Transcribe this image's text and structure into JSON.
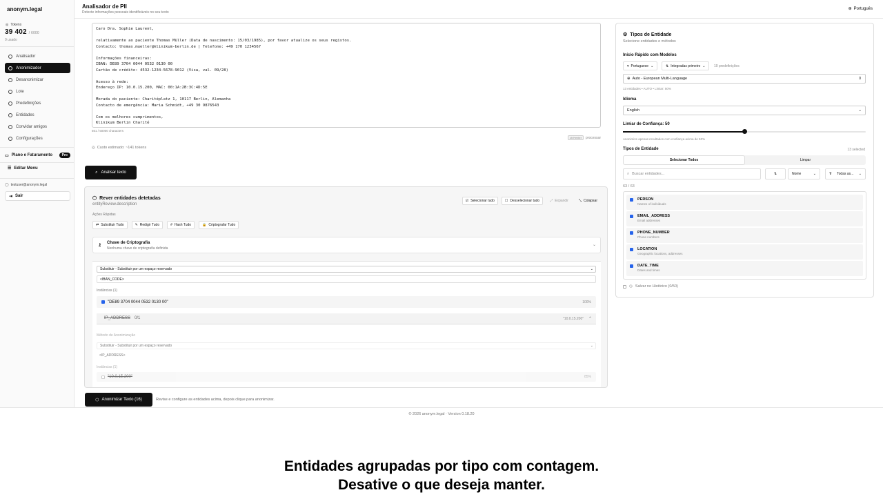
{
  "brand": "anonym.legal",
  "tokens": {
    "label": "Tokens",
    "count": "39 402",
    "total": "/ 6000",
    "used": "0 usado"
  },
  "nav": [
    {
      "label": "Analisador"
    },
    {
      "label": "Anonimizador"
    },
    {
      "label": "Desanonimizar"
    },
    {
      "label": "Lote"
    },
    {
      "label": "Predefinições"
    },
    {
      "label": "Entidades"
    },
    {
      "label": "Convidar amigos"
    },
    {
      "label": "Configurações"
    }
  ],
  "plan": {
    "label": "Plano e Faturamento",
    "badge": "Pro"
  },
  "edit_menu": "Editar Menu",
  "user": {
    "email": "testuser@anonym.legal",
    "logout": "Sair"
  },
  "header": {
    "title": "Analisador de PII",
    "subtitle": "Detecte informações pessoais identificáveis no seu texto",
    "language": "Português"
  },
  "input": {
    "text": "Caro Dra. Sophie Laurent,\n\nrelativamente ao paciente Thomas Müller (Data de nascimento: 15/03/1985), por favor atualize os seus registos.\nContacto: thomas.mueller@klinikum-berlin.de | Telefone: +49 170 1234567\n\nInformações financeiras:\nIBAN: DE89 3704 0044 0532 0130 00\nCartão de crédito: 4532-1234-5678-9012 (Visa, val. 09/28)\n\nAcesso à rede:\nEndereço IP: 10.0.15.200, MAC: 00:1A:2B:3C:4D:5E\n\nMorada do paciente: Charitéplatz 1, 10117 Berlin, Alemanha\nContacto de emergência: Maria Schmidt, +49 30 9876543\n\nCom os melhores cumprimentos,\nKlinikum Berlin Charité",
    "char_count": "561 / 50000 characters",
    "kbd": "ctrl+enter",
    "hint_suffix": "processar",
    "cost": "Custo estimado: ~141 tokens"
  },
  "analyze_button": "Analisar texto",
  "review": {
    "title": "Rever entidades detetadas",
    "subtitle": "entityReview.description",
    "actions": [
      "Selecionar tudo",
      "Desselecionar tudo",
      "Expandir",
      "Colapsar"
    ],
    "quick_label": "Ações Rápidas",
    "quick": [
      "Substituir Tudo",
      "Redigir Tudo",
      "Hash Tudo",
      "Criptografar Tudo"
    ],
    "crypto_title": "Chave de Criptografia",
    "crypto_sub": "Nenhuma chave de criptografia definida",
    "method_select": "Substituir - Substituir por um espaço reservado",
    "iban_placeholder": "<IBAN_CODE>",
    "instances_label": "Instâncias (1)",
    "iban_value": "\"DE89 3704 0044 0532 0130 00\"",
    "iban_pct": "100%",
    "ip_name": "IP_ADDRESS",
    "ip_count": "0/1",
    "ip_preview": "\"10.0.15.200\"",
    "method_label": "Método de Anonimização",
    "ip_method": "Substituir - Substituir por um espaço reservado",
    "ip_placeholder": "<IP_ADDRESS>",
    "ip_instances_label": "Instâncias (1)",
    "ip_value": "\"10.0.15.200\"",
    "ip_pct": "85%"
  },
  "anon_button": "Anonimizar Texto (16)",
  "anon_hint": "Revise e configure as entidades acima, depois clique para anonimizar.",
  "footer": "© 2026 anonym.legal · Version 0.18.20",
  "right": {
    "title": "Tipos de Entidade",
    "subtitle": "Selecione entidades e métodos",
    "quick_label": "Início Rápido com Modelos",
    "lang_pill": "Portuguese",
    "sort_pill": "Integradas primeiro",
    "presets": "10 predefinições",
    "model": "Auto - European Multi-Language",
    "model_note": "13 entidades • AUTO • Limiar: 50%",
    "language_label": "Idioma",
    "language_value": "English",
    "confidence_label": "Limiar de Confiança: 50",
    "confidence_value": 0.5,
    "confidence_note": "Anonimize apenas resultados com confiança acima de 50%",
    "types_label": "Tipos de Entidade",
    "types_count": "13 selected",
    "select_all": "Selecionar Todos",
    "clear": "Limpar",
    "search_placeholder": "Buscar entidades...",
    "sort_label": "Nome",
    "filter_label": "Todas as...",
    "list_count": "63 / 63",
    "entities": [
      {
        "name": "PERSON",
        "desc": "Names of individuals"
      },
      {
        "name": "EMAIL_ADDRESS",
        "desc": "Email addresses"
      },
      {
        "name": "PHONE_NUMBER",
        "desc": "Phone numbers"
      },
      {
        "name": "LOCATION",
        "desc": "Geographic locations, addresses"
      },
      {
        "name": "DATE_TIME",
        "desc": "Dates and times"
      }
    ],
    "save_history": "Salvar no Histórico (0/50)"
  },
  "caption": [
    "Entidades agrupadas por tipo com contagem.",
    "Desative o que deseja manter."
  ],
  "colors": {
    "accent": "#111111",
    "checkbox": "#2563eb"
  }
}
